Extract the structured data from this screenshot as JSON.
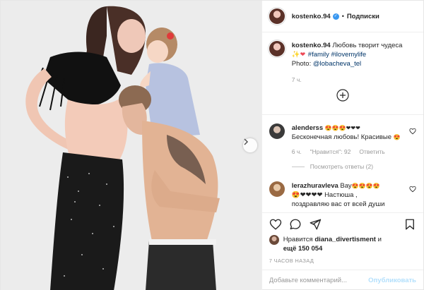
{
  "post": {
    "author": "kostenko.94",
    "verified": true,
    "separator": "•",
    "follow_label": "Подписки"
  },
  "caption": {
    "username": "kostenko.94",
    "text": "Любовь творит чудеса",
    "emoji_sparkle": "✨",
    "emoji_heart": "❤",
    "hashtag1": "#family",
    "hashtag2": "#ilovemylife",
    "photo_prefix": "Photo:",
    "photo_credit": "@lobacheva_tel",
    "time": "7 ч."
  },
  "comments": [
    {
      "username": "alenderss",
      "emoji_prefix": "😍😍😍❤❤❤",
      "text": "Бесконечная любовь! Красивые",
      "emoji_suffix": "😍",
      "time": "6 ч.",
      "likes": "\"Нравится\": 92",
      "reply": "Ответить",
      "view_replies": "Посмотреть ответы (2)"
    },
    {
      "username": "lerazhuravleva",
      "text_lead": "Вау",
      "emoji_prefix": "😍😍😍😍",
      "line2": "😍❤❤❤❤ Настюша ,",
      "line3": "поздравляю вас от всей души"
    }
  ],
  "likes_summary": {
    "prefix": "Нравится",
    "user": "diana_divertisment",
    "suffix": "и",
    "others": "ещё 150 054"
  },
  "date": "7 ЧАСОВ НАЗАД",
  "add_comment": {
    "placeholder": "Добавьте комментарий...",
    "publish_label": "Опубликовать"
  },
  "icons": {
    "heart": "heart-icon",
    "comment": "comment-icon",
    "share": "share-icon",
    "save": "bookmark-icon",
    "add": "add-circle-icon",
    "next": "chevron-right-icon"
  },
  "colors": {
    "link": "#003569",
    "verified": "#3897f0",
    "publish_disabled": "#b2dffc",
    "muted": "#999999"
  }
}
